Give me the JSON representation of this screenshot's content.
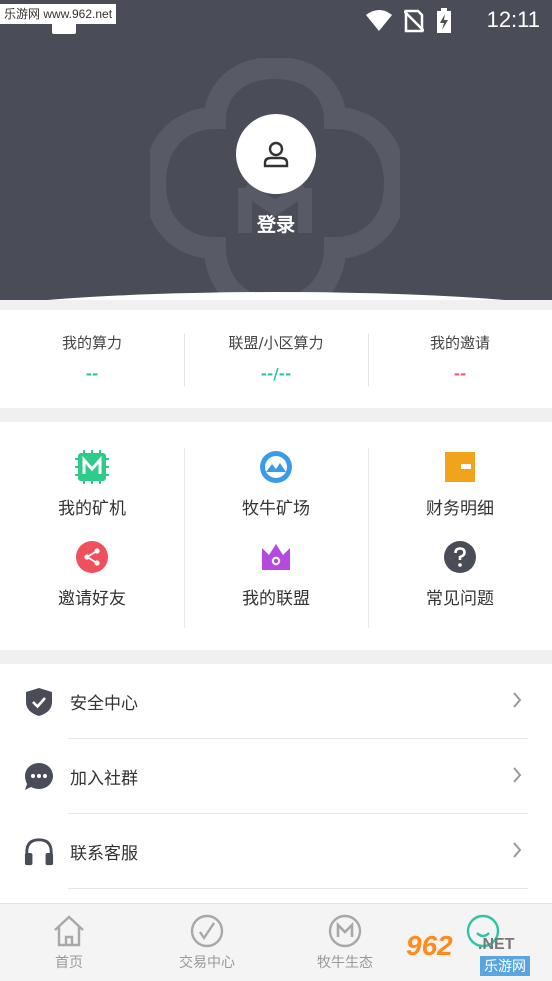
{
  "status_bar": {
    "watermark": "乐游网 www.962.net",
    "time": "12:11",
    "icons": [
      "wifi-icon",
      "no-sim-icon",
      "battery-charging-icon"
    ]
  },
  "header": {
    "login_label": "登录",
    "avatar_icon": "user-icon"
  },
  "stats": [
    {
      "label": "我的算力",
      "value": "--",
      "color": "#2ec4a3"
    },
    {
      "label": "联盟/小区算力",
      "value": "--/--",
      "color": "#2ec4a3"
    },
    {
      "label": "我的邀请",
      "value": "--",
      "color": "#f05a6a"
    }
  ],
  "grid": [
    {
      "label": "我的矿机",
      "icon": "miner-chip-icon",
      "color": "#2ecc8a"
    },
    {
      "label": "牧牛矿场",
      "icon": "mountain-icon",
      "color": "#3a9be8"
    },
    {
      "label": "财务明细",
      "icon": "wallet-icon",
      "color": "#f2a31c"
    },
    {
      "label": "邀请好友",
      "icon": "share-icon",
      "color": "#f0505e"
    },
    {
      "label": "我的联盟",
      "icon": "crown-icon",
      "color": "#b44ae0"
    },
    {
      "label": "常见问题",
      "icon": "question-icon",
      "color": "#4a4d58"
    }
  ],
  "menu": [
    {
      "label": "安全中心",
      "icon": "shield-check-icon"
    },
    {
      "label": "加入社群",
      "icon": "chat-bubble-icon"
    },
    {
      "label": "联系客服",
      "icon": "headphones-icon"
    }
  ],
  "tabs": [
    {
      "label": "首页",
      "icon": "home-icon"
    },
    {
      "label": "交易中心",
      "icon": "exchange-icon"
    },
    {
      "label": "牧牛生态",
      "icon": "m-logo-icon"
    },
    {
      "label": "",
      "icon": "profile-icon"
    }
  ],
  "watermark": {
    "num": "962",
    "net": ".NET",
    "cn": "乐游网"
  },
  "colors": {
    "header": "#4a4d58",
    "accent": "#2ec4a3"
  }
}
